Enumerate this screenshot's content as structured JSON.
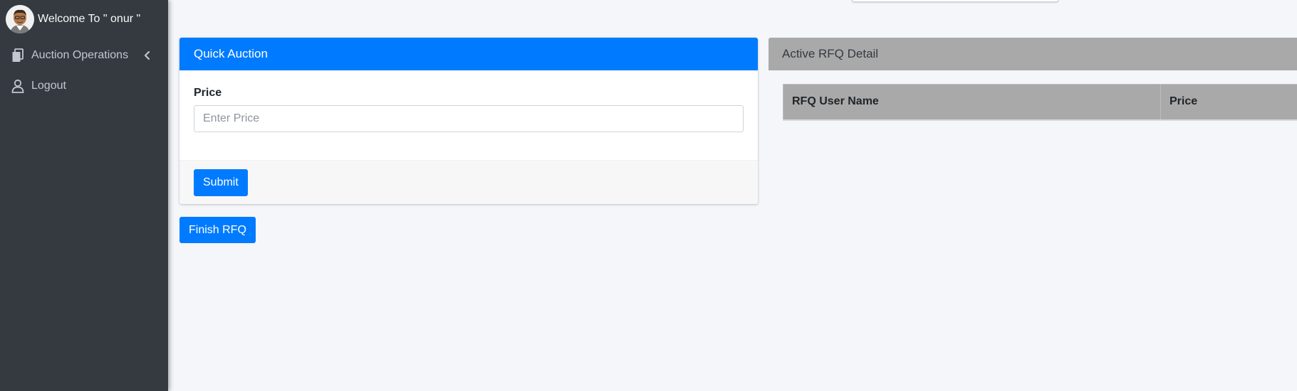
{
  "sidebar": {
    "user_name": "Welcome To \" onur \"",
    "items": [
      {
        "label": "Auction Operations",
        "icon": "copy-icon"
      },
      {
        "label": "Logout",
        "icon": "user-icon"
      }
    ]
  },
  "quick_auction": {
    "title": "Quick Auction",
    "price_label": "Price",
    "price_value": "",
    "price_placeholder": "Enter Price",
    "submit_label": "Submit"
  },
  "finish_label": "Finish RFQ",
  "rfq": {
    "title": "Active RFQ Detail",
    "columns": [
      "RFQ User Name",
      "Price"
    ]
  },
  "colors": {
    "sidebar_bg": "#343a40",
    "primary": "#007bff",
    "rfq_header": "#a9a9a9",
    "page_bg": "#f4f6f9"
  }
}
